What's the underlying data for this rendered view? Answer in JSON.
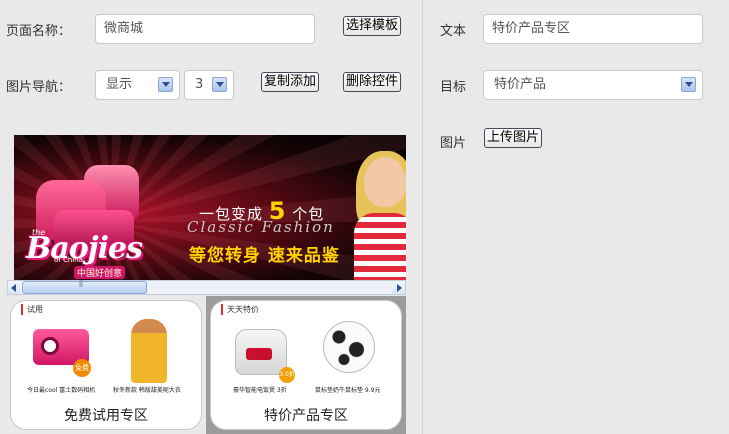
{
  "left_form": {
    "page_name_label": "页面名称：",
    "page_name_value": "微商城",
    "choose_template_button": "选择模板",
    "image_nav_label": "图片导航：",
    "display_select": "显示",
    "count_select": "3",
    "copy_add_button": "复制添加",
    "delete_control_button": "删除控件"
  },
  "right_form": {
    "text_label": "文本",
    "text_value": "特价产品专区",
    "target_label": "目标",
    "target_select": "特价产品",
    "image_label": "图片",
    "upload_button": "上传图片"
  },
  "banner": {
    "logo": "Baojies",
    "logo_prefix": "the",
    "logo_small": "of China",
    "logo_sub": "中国好创意",
    "slogan_part1": "一包变成",
    "slogan_number": "5",
    "slogan_part2": "个包",
    "slogan_en": "Classic Fashion",
    "slogan_cn": "等您转身  速来品鉴"
  },
  "cards": [
    {
      "tag": "试用",
      "caption": "免费试用专区",
      "product1_caption": "今日最cool 富士数码相机",
      "product1_badge": "免费",
      "product2_caption": "秋冬新款 韩版甜美呢大衣"
    },
    {
      "tag": "天天特价",
      "caption": "特价产品专区",
      "product1_caption": "豪华智能电饭煲 3折",
      "product1_badge": "3.0折",
      "product2_caption": "鼠标垫奶牛鼠标垫 9.9元"
    }
  ],
  "colors": {
    "background": "#e9e9e9",
    "card_selected_bg": "#9c9c9c",
    "slogan_highlight": "#ffd200"
  }
}
